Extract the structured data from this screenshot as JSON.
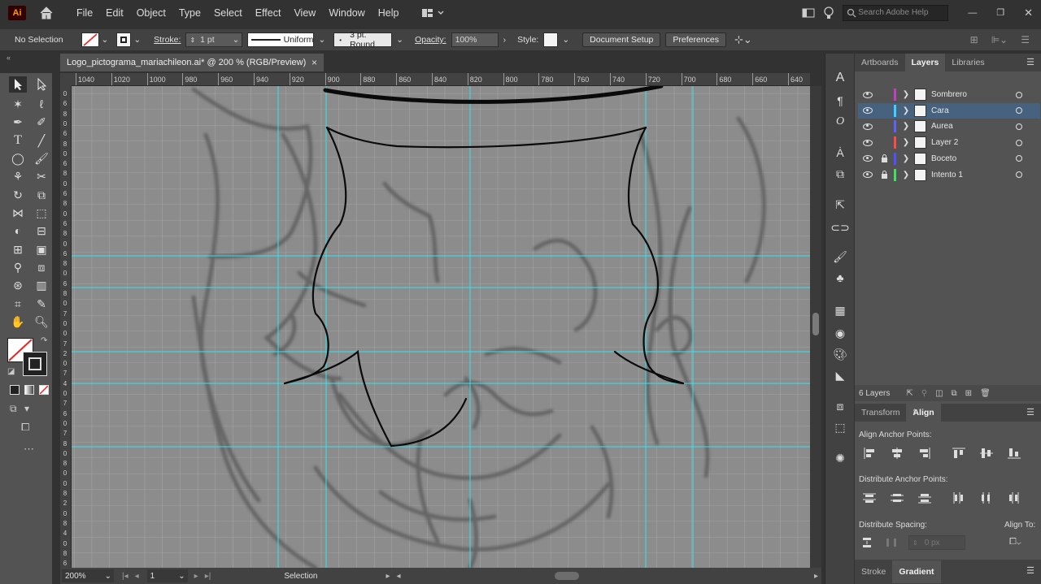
{
  "app": {
    "logo": "Ai"
  },
  "menu": [
    "File",
    "Edit",
    "Object",
    "Type",
    "Select",
    "Effect",
    "View",
    "Window",
    "Help"
  ],
  "search": {
    "placeholder": "Search Adobe Help"
  },
  "control": {
    "selection_state": "No Selection",
    "stroke_label": "Stroke:",
    "stroke_value": "1 pt",
    "profile": "Uniform",
    "brush": "3 pt. Round",
    "opacity_label": "Opacity:",
    "opacity_value": "100%",
    "style_label": "Style:",
    "document_setup": "Document Setup",
    "preferences": "Preferences"
  },
  "document": {
    "tab_title": "Logo_pictograma_mariachileon.ai* @ 200 % (RGB/Preview)",
    "close": "×"
  },
  "ruler": {
    "h_ticks": [
      "1040",
      "1020",
      "1000",
      "980",
      "960",
      "940",
      "920",
      "900",
      "880",
      "860",
      "840",
      "820",
      "800",
      "780",
      "760",
      "740",
      "720",
      "700",
      "680",
      "660",
      "640"
    ],
    "v_ticks": [
      "0",
      "6",
      "8",
      "0",
      "6",
      "8",
      "0",
      "6",
      "8",
      "0",
      "6",
      "8",
      "0",
      "6",
      "8",
      "0",
      "6",
      "8",
      "0",
      "6",
      "8",
      "0",
      "7",
      "0",
      "0",
      "7",
      "2",
      "0",
      "7",
      "4",
      "0",
      "7",
      "6",
      "0",
      "7",
      "8",
      "0",
      "8",
      "0",
      "0",
      "8",
      "2",
      "0",
      "8",
      "4",
      "0",
      "8",
      "6"
    ]
  },
  "status": {
    "zoom": "200%",
    "page": "1",
    "tool": "Selection"
  },
  "panel": {
    "top_tabs": [
      "Artboards",
      "Layers",
      "Libraries"
    ],
    "layers": [
      {
        "name": "Sombrero",
        "color": "#c040c0",
        "locked": false,
        "selected": false
      },
      {
        "name": "Cara",
        "color": "#40d0ff",
        "locked": false,
        "selected": true
      },
      {
        "name": "Aurea",
        "color": "#6060ff",
        "locked": false,
        "selected": false
      },
      {
        "name": "Layer 2",
        "color": "#ff4a4a",
        "locked": false,
        "selected": false
      },
      {
        "name": "Boceto",
        "color": "#5050ff",
        "locked": true,
        "selected": false
      },
      {
        "name": "Intento 1",
        "color": "#40e060",
        "locked": true,
        "selected": false
      }
    ],
    "layer_count": "6 Layers",
    "mid_tabs": [
      "Transform",
      "Align"
    ],
    "align_anchor_label": "Align Anchor Points:",
    "distribute_anchor_label": "Distribute Anchor Points:",
    "distribute_spacing_label": "Distribute Spacing:",
    "spacing_value": "0 px",
    "align_to_label": "Align To:",
    "bottom_tabs": [
      "Stroke",
      "Gradient"
    ]
  }
}
